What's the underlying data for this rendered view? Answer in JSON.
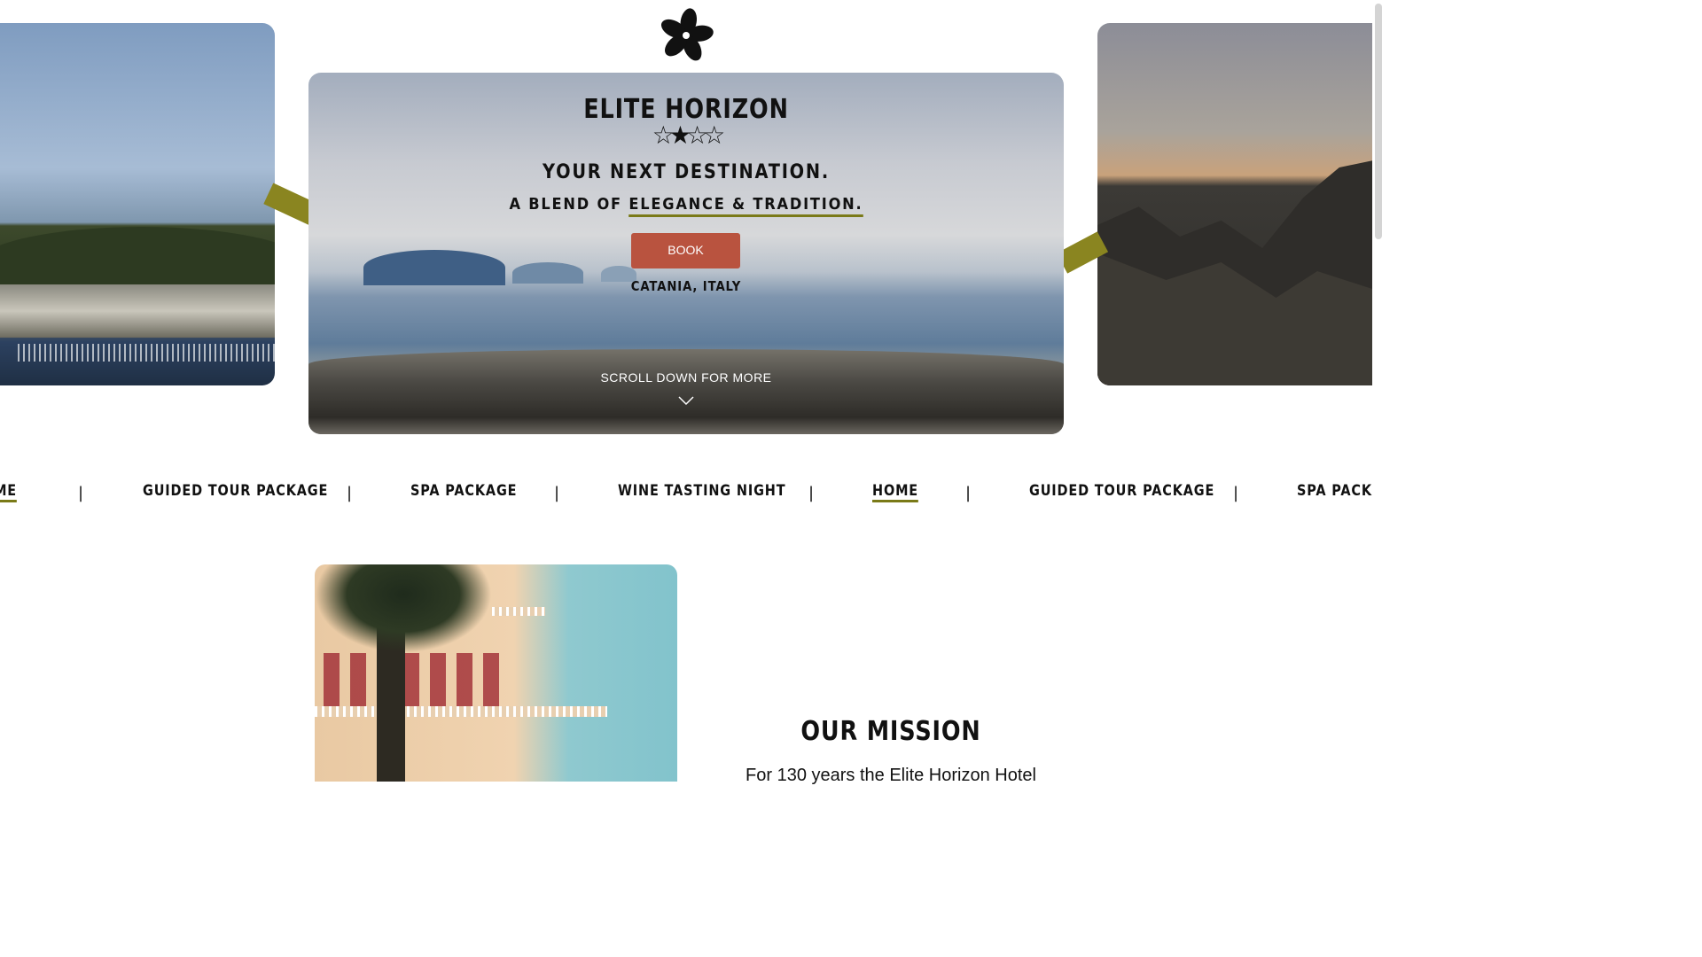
{
  "brand": {
    "name": "ELITE HORIZON",
    "stars": "☆★☆☆"
  },
  "hero": {
    "tagline_main": "YOUR NEXT DESTINATION.",
    "tagline_prefix": "A BLEND OF",
    "tagline_highlight": "ELEGANCE & TRADITION.",
    "book_label": "BOOK",
    "location": "CATANIA, ITALY",
    "scroll_label": "SCROLL DOWN FOR MORE"
  },
  "nav": {
    "items": [
      {
        "label": "HOME",
        "active": true
      },
      {
        "label": "GUIDED TOUR PACKAGE"
      },
      {
        "label": "SPA PACKAGE"
      },
      {
        "label": "WINE TASTING NIGHT"
      },
      {
        "label": "HOME",
        "active": true
      },
      {
        "label": "GUIDED TOUR PACKAGE"
      },
      {
        "label": "SPA PACKAGE"
      }
    ],
    "separator": "|"
  },
  "mission": {
    "title": "OUR MISSION",
    "text": "For 130 years the Elite Horizon Hotel"
  },
  "colors": {
    "accent": "#b9533f",
    "ribbon": "#8a8520",
    "underline": "#7a7a18"
  }
}
